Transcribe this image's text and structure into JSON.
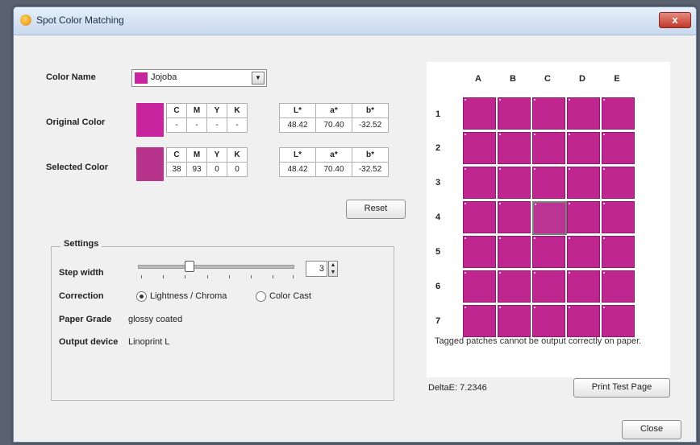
{
  "window": {
    "title": "Spot Color Matching",
    "close_glyph": "x"
  },
  "color_name": {
    "label": "Color Name",
    "value": "Jojoba",
    "swatch_color": "#c8249e"
  },
  "original": {
    "label": "Original Color",
    "swatch_color": "#c8249e",
    "cmyk_headers": [
      "C",
      "M",
      "Y",
      "K"
    ],
    "cmyk_values": [
      "-",
      "-",
      "-",
      "-"
    ],
    "lab_headers": [
      "L*",
      "a*",
      "b*"
    ],
    "lab_values": [
      "48.42",
      "70.40",
      "-32.52"
    ]
  },
  "selected": {
    "label": "Selected Color",
    "swatch_color": "#b8348c",
    "cmyk_headers": [
      "C",
      "M",
      "Y",
      "K"
    ],
    "cmyk_values": [
      "38",
      "93",
      "0",
      "0"
    ],
    "lab_headers": [
      "L*",
      "a*",
      "b*"
    ],
    "lab_values": [
      "48.42",
      "70.40",
      "-32.52"
    ]
  },
  "reset_label": "Reset",
  "settings": {
    "title": "Settings",
    "step_width_label": "Step width",
    "step_width_value": "3",
    "correction_label": "Correction",
    "correction_options": [
      "Lightness / Chroma",
      "Color Cast"
    ],
    "correction_selected": "Lightness / Chroma",
    "paper_grade_label": "Paper Grade",
    "paper_grade_value": "glossy coated",
    "output_device_label": "Output device",
    "output_device_value": "Linoprint L"
  },
  "patch_grid": {
    "columns": [
      "A",
      "B",
      "C",
      "D",
      "E"
    ],
    "rows": [
      "1",
      "2",
      "3",
      "4",
      "5",
      "6",
      "7"
    ],
    "selected_patch": "C4",
    "patch_color": "#c0268f",
    "note": "Tagged patches cannot be output correctly on paper."
  },
  "delta_e": "DeltaE: 7.2346",
  "print_test_page_label": "Print Test Page",
  "close_label": "Close"
}
